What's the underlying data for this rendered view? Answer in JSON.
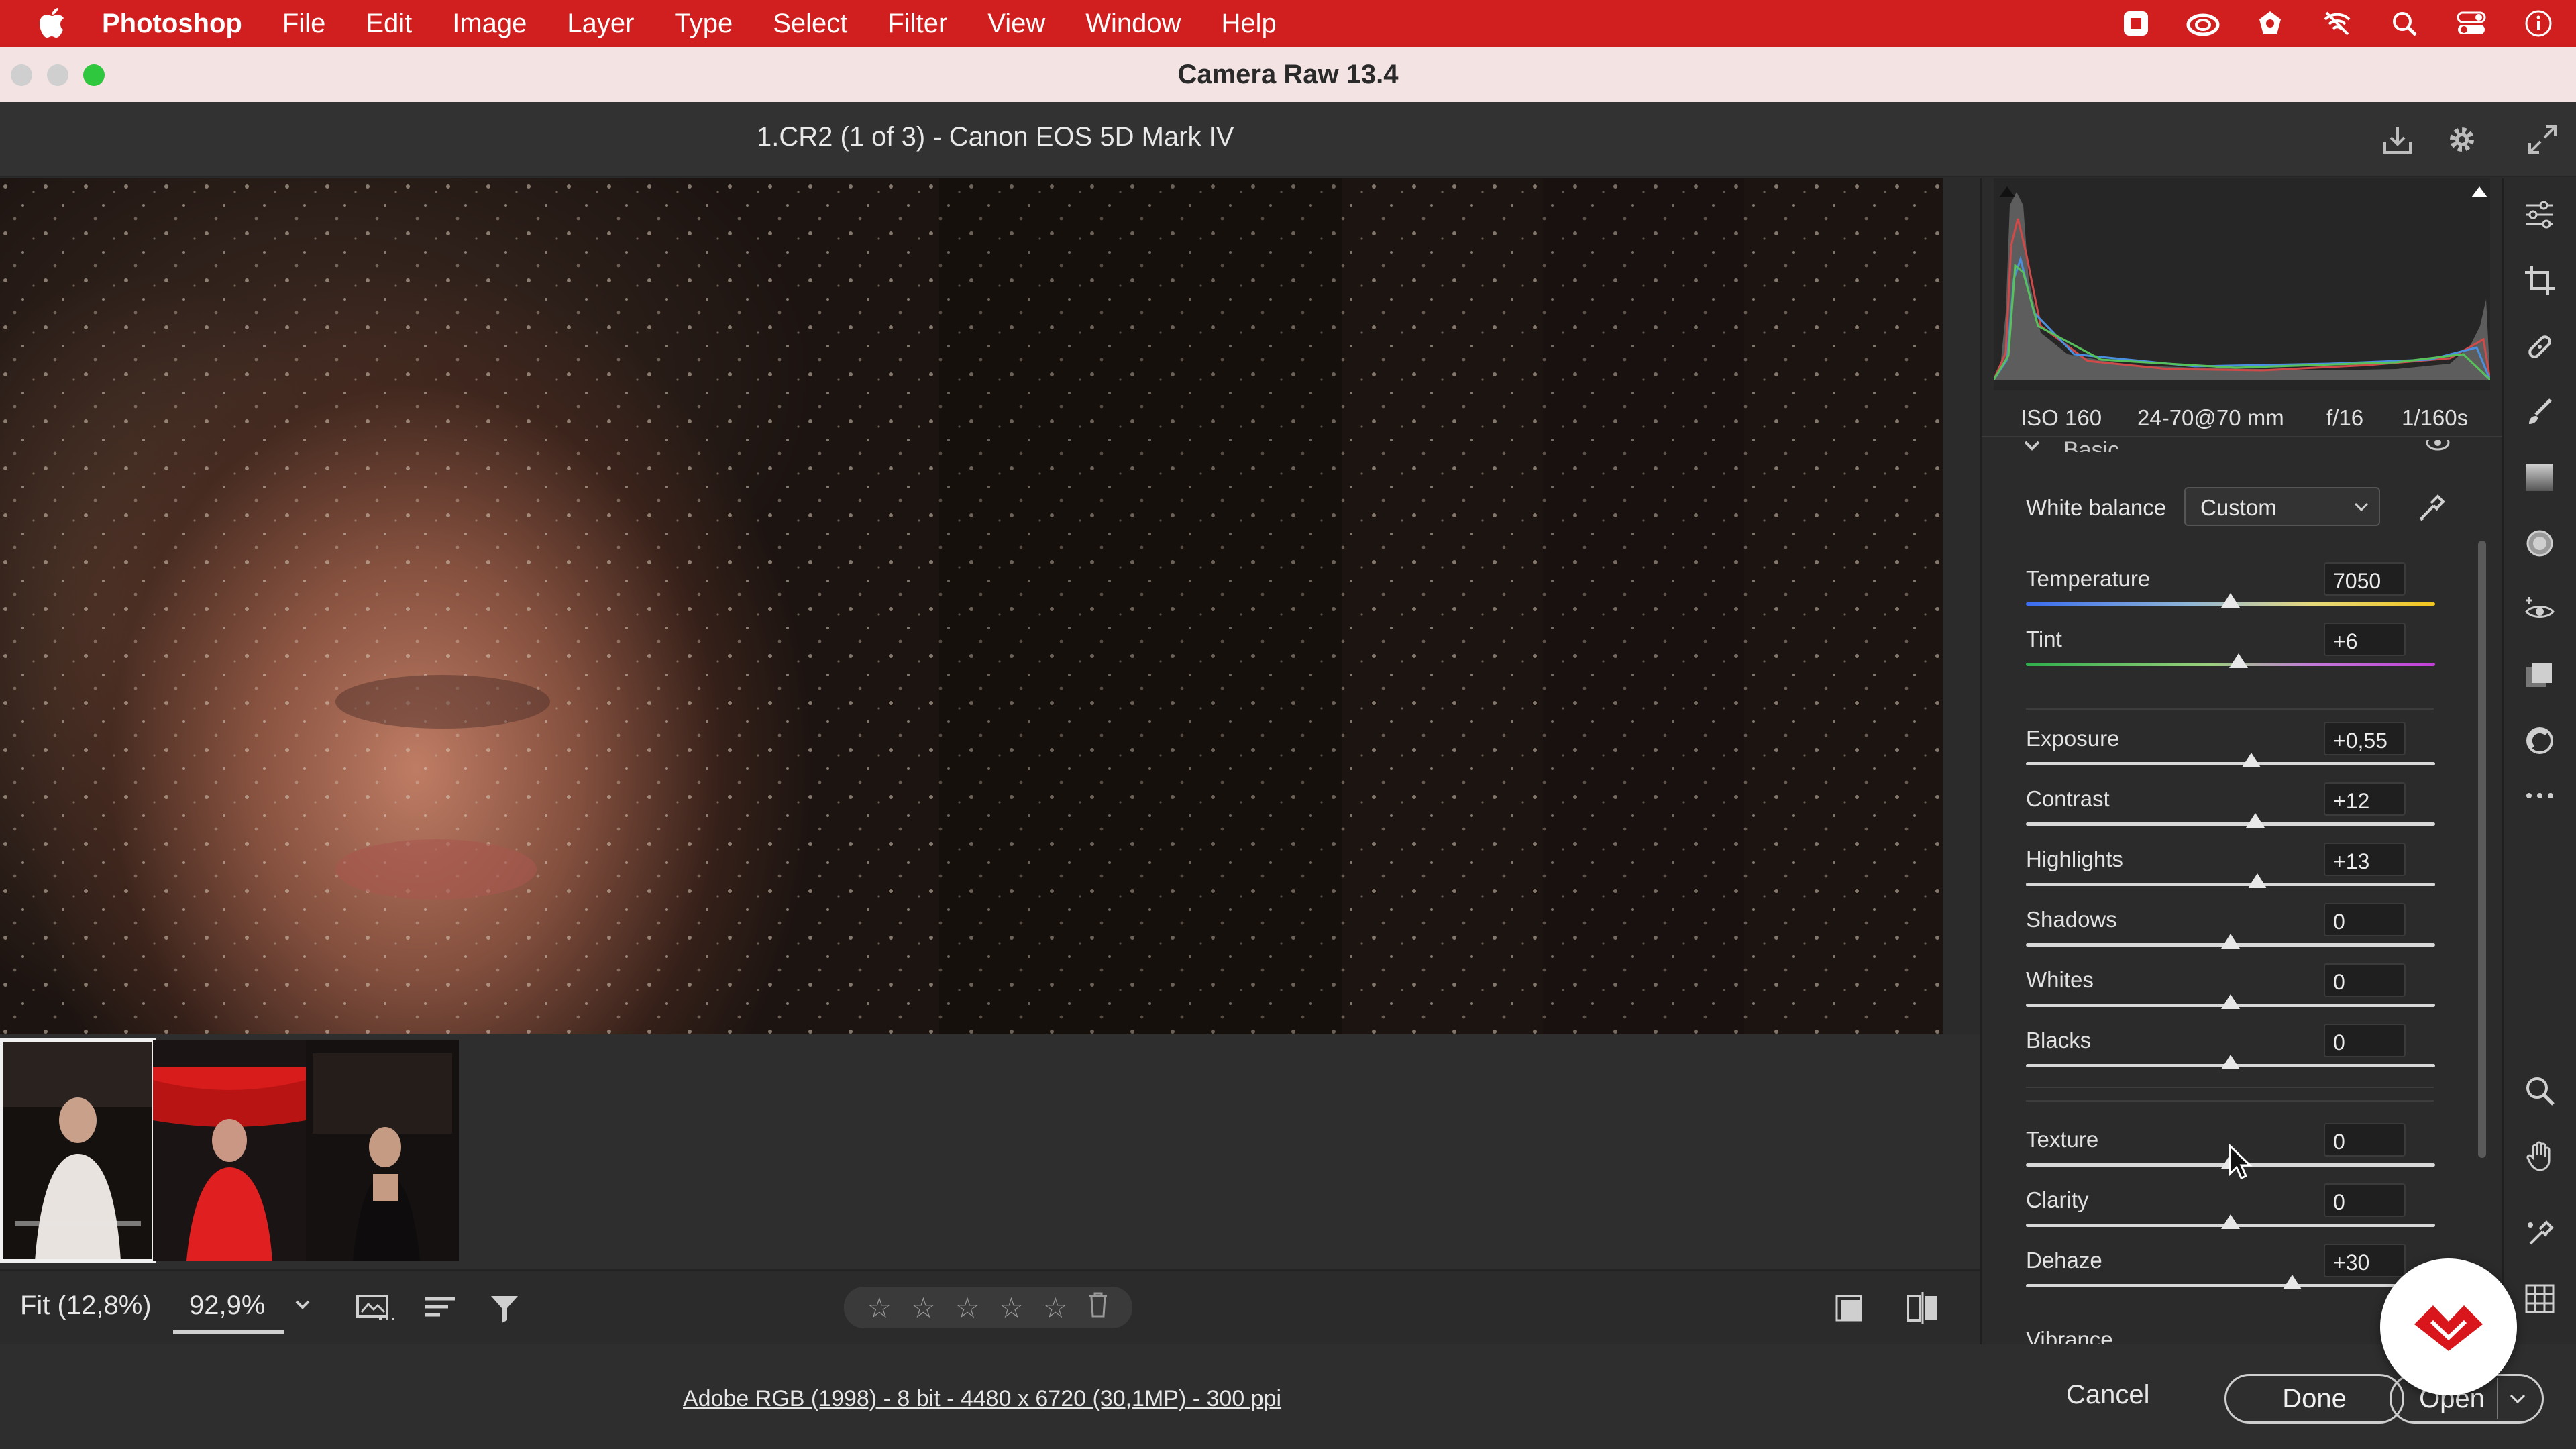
{
  "menubar": {
    "app_name": "Photoshop",
    "items": [
      "File",
      "Edit",
      "Image",
      "Layer",
      "Type",
      "Select",
      "Filter",
      "View",
      "Window",
      "Help"
    ],
    "status_icons": [
      "record-icon",
      "creative-cloud-icon",
      "sync-icon",
      "wifi-off-icon",
      "search-icon",
      "control-center-icon",
      "info-icon"
    ]
  },
  "window": {
    "title": "Camera Raw 13.4"
  },
  "header": {
    "file_title": "1.CR2 (1 of 3)  -  Canon EOS 5D Mark IV"
  },
  "metadata": {
    "iso": "ISO 160",
    "lens": "24-70@70 mm",
    "aperture": "f/16",
    "shutter": "1/160s"
  },
  "basic": {
    "section_title": "Basic",
    "white_balance_label": "White balance",
    "white_balance_value": "Custom",
    "sliders": [
      {
        "name": "Temperature",
        "value": "7050",
        "position": 0.5
      },
      {
        "name": "Tint",
        "value": "+6",
        "position": 0.52
      },
      {
        "name": "Exposure",
        "value": "+0,55",
        "position": 0.55
      },
      {
        "name": "Contrast",
        "value": "+12",
        "position": 0.56
      },
      {
        "name": "Highlights",
        "value": "+13",
        "position": 0.565
      },
      {
        "name": "Shadows",
        "value": "0",
        "position": 0.5
      },
      {
        "name": "Whites",
        "value": "0",
        "position": 0.5
      },
      {
        "name": "Blacks",
        "value": "0",
        "position": 0.5
      },
      {
        "name": "Texture",
        "value": "0",
        "position": 0.5
      },
      {
        "name": "Clarity",
        "value": "0",
        "position": 0.5
      },
      {
        "name": "Dehaze",
        "value": "+30",
        "position": 0.65
      }
    ],
    "next_label": "Vibrance"
  },
  "bottom_toolbar": {
    "fit_label": "Fit (12,8%)",
    "zoom_value": "92,9%",
    "rating_stars": 5
  },
  "statusbar": {
    "workflow_text": "Adobe RGB (1998) - 8 bit - 4480 x 6720 (30,1MP) - 300 ppi",
    "cancel_label": "Cancel",
    "done_label": "Done",
    "open_label": "Open"
  },
  "colors": {
    "menubar": "#d11f1f",
    "titlebar": "#f3e3e3",
    "panel": "#2b2b2b",
    "badge_red": "#d8161c"
  }
}
